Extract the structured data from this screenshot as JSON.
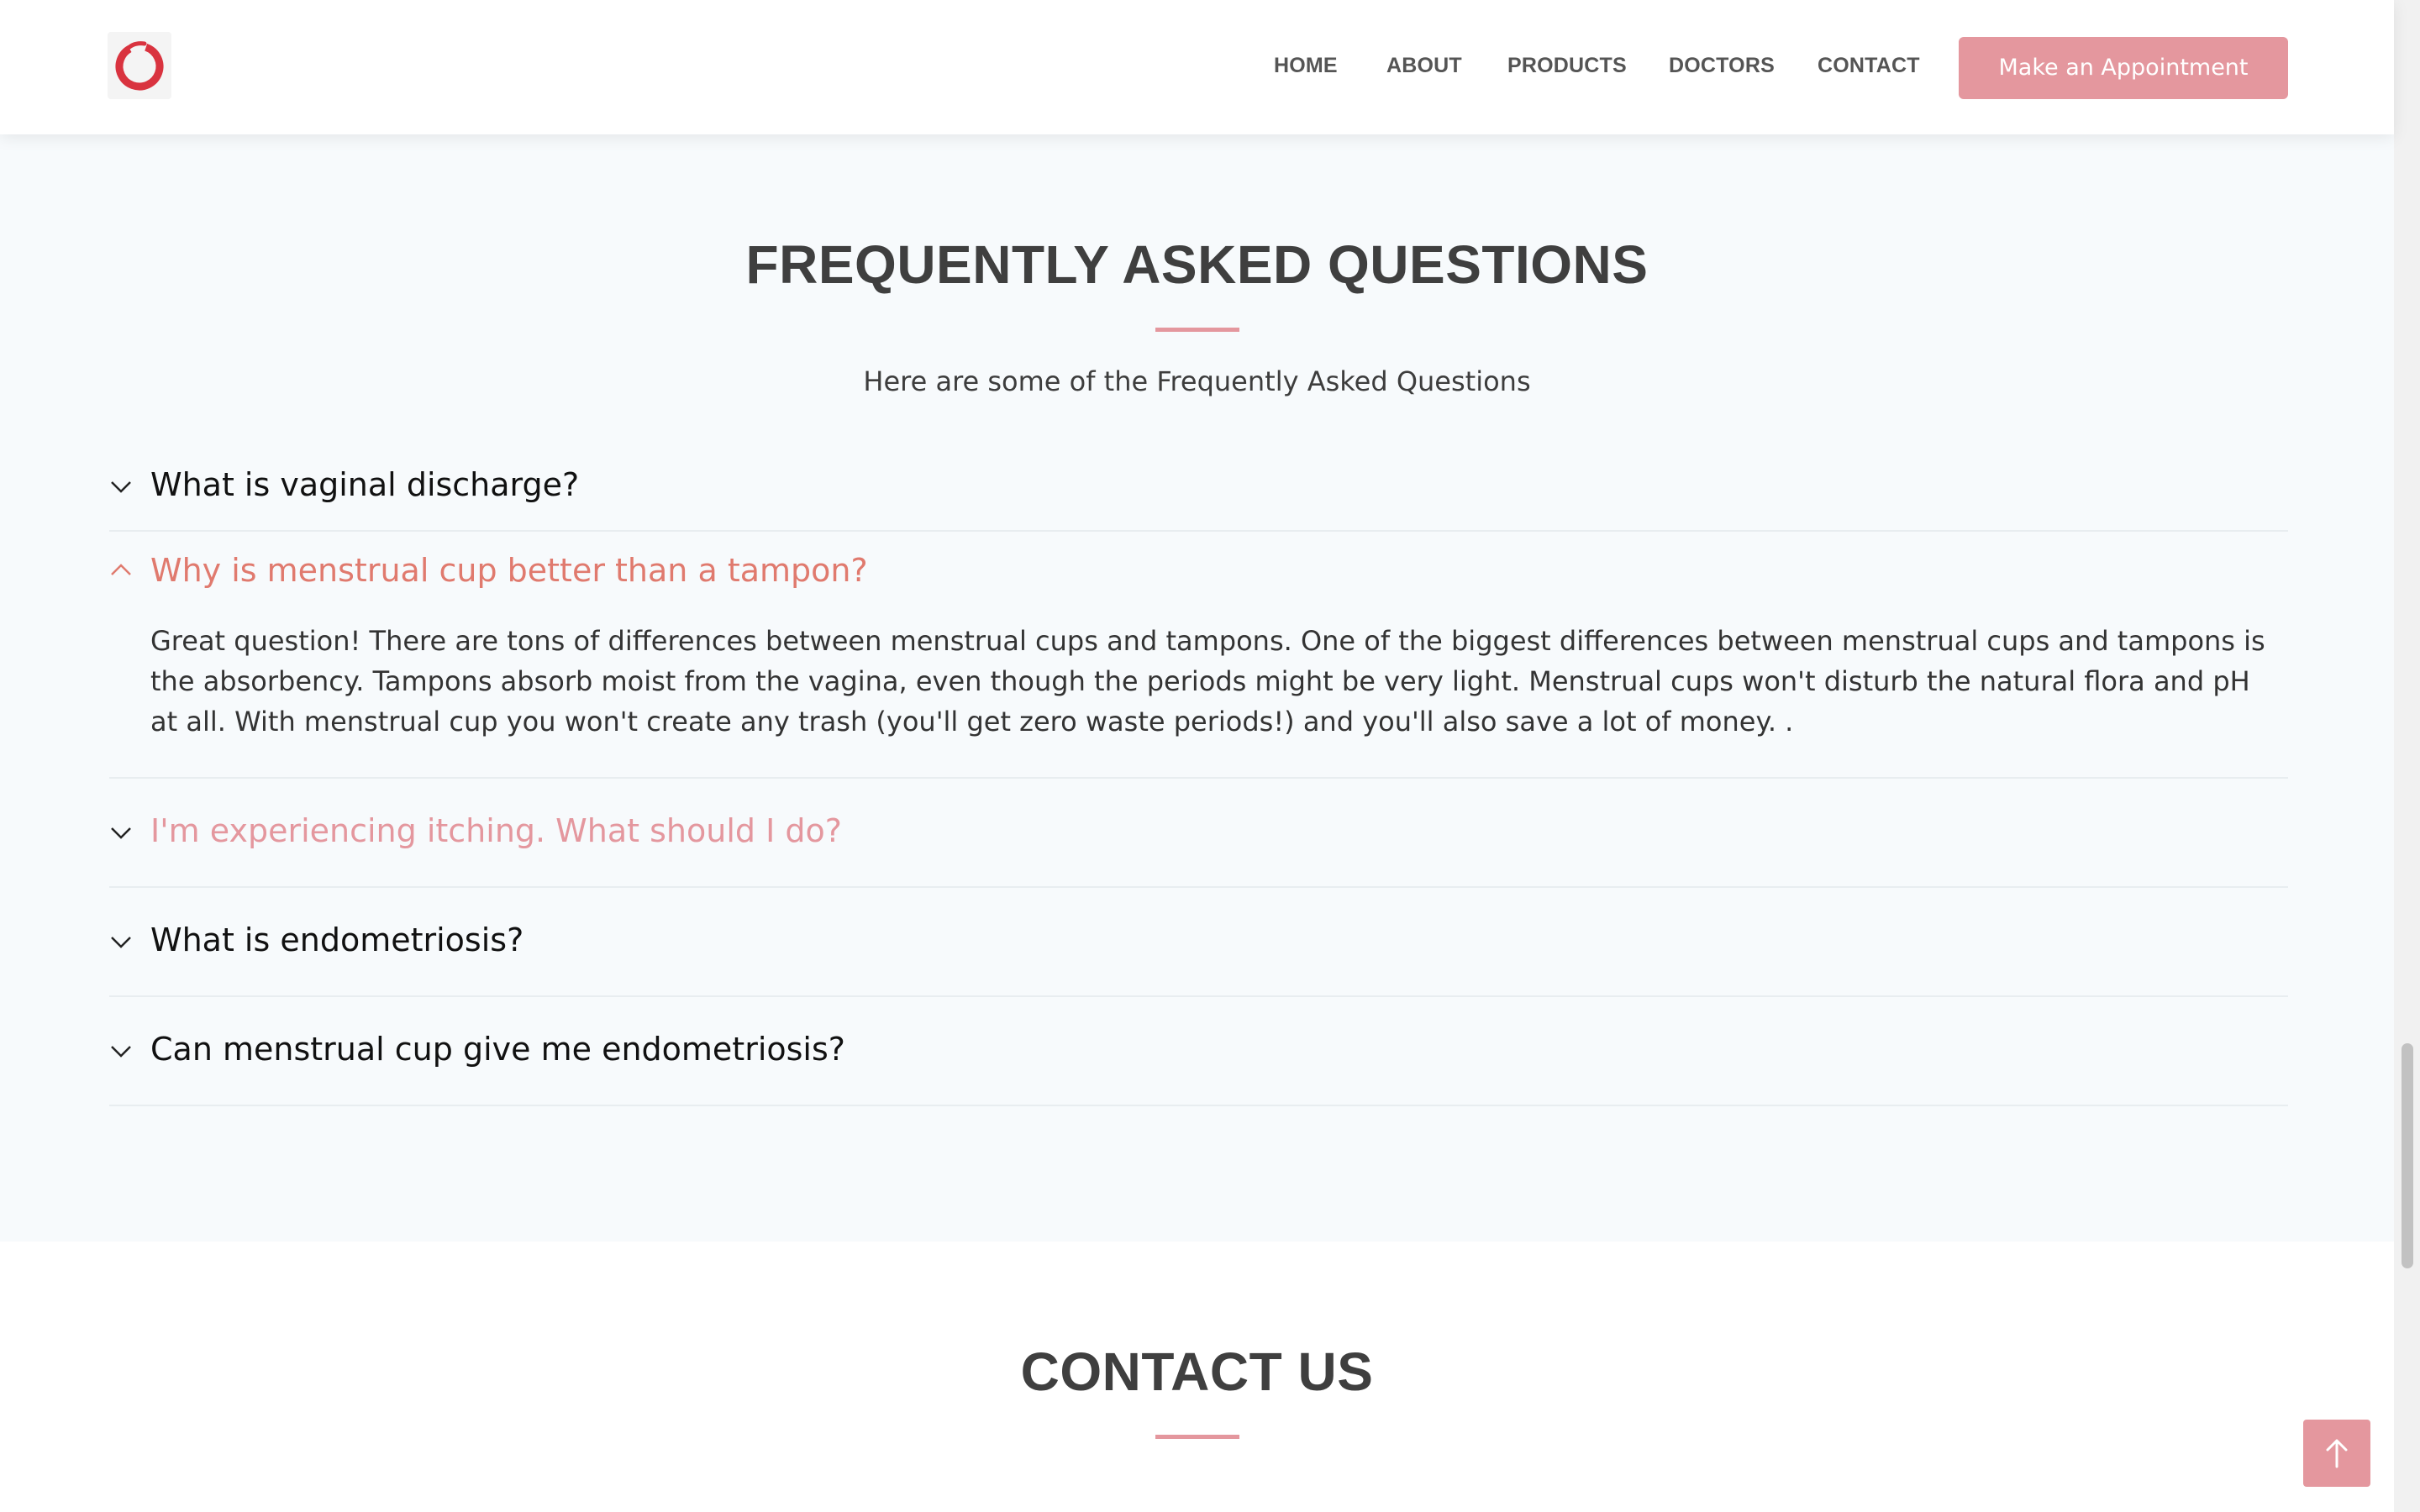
{
  "header": {
    "logo_icon": "red-ring-logo-icon",
    "nav": [
      {
        "label": "HOME"
      },
      {
        "label": "ABOUT"
      },
      {
        "label": "PRODUCTS"
      },
      {
        "label": "DOCTORS"
      },
      {
        "label": "CONTACT"
      }
    ],
    "appointment_button": "Make an Appointment"
  },
  "faq": {
    "title": "FREQUENTLY ASKED QUESTIONS",
    "subtitle": "Here are some of the Frequently Asked Questions",
    "items": [
      {
        "question": "What is vaginal discharge?",
        "expanded": false,
        "icon": "chevron-down-icon"
      },
      {
        "question": "Why is menstrual cup better than a tampon?",
        "expanded": true,
        "icon": "chevron-up-icon",
        "answer": "Great question! There are tons of differences between menstrual cups and tampons. One of the biggest differences between menstrual cups and tampons is the absorbency. Tampons absorb moist from the vagina, even though the periods might be very light. Menstrual cups won't disturb the natural flora and pH at all. With menstrual cup you won't create any trash (you'll get zero waste periods!) and you'll also save a lot of money. ."
      },
      {
        "question": "I'm experiencing itching. What should I do?",
        "expanded": false,
        "icon": "chevron-down-icon"
      },
      {
        "question": "What is endometriosis?",
        "expanded": false,
        "icon": "chevron-down-icon"
      },
      {
        "question": "Can menstrual cup give me endometriosis?",
        "expanded": false,
        "icon": "chevron-down-icon"
      }
    ]
  },
  "contact": {
    "title": "CONTACT US"
  },
  "back_to_top_icon": "arrow-up-icon",
  "colors": {
    "accent": "#e4979e",
    "active_question": "#e07a6e",
    "section_bg": "#f7fafc"
  }
}
